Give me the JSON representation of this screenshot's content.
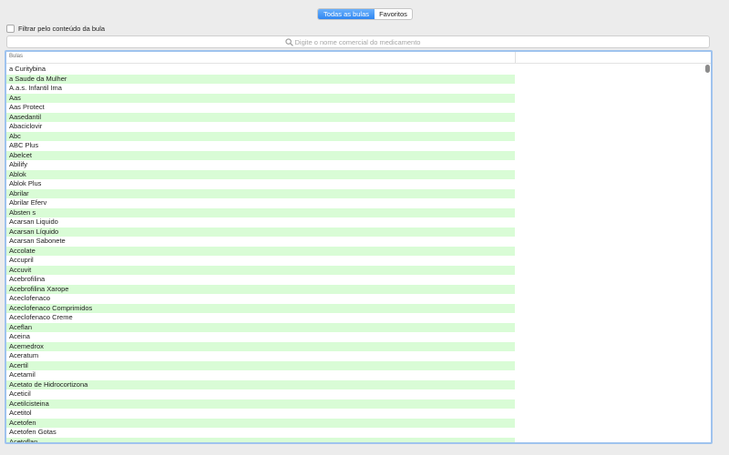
{
  "tabs": {
    "all_label": "Todas as bulas",
    "favorites_label": "Favoritos"
  },
  "filter": {
    "checked": false,
    "label": "Filtrar pelo conteúdo da bula"
  },
  "search": {
    "placeholder": "Digite o nome comercial do medicamento",
    "value": ""
  },
  "table": {
    "column_header": "Bulas",
    "rows": [
      "a Curitybina",
      "a Saude da Mulher",
      "A.a.s. Infantil Ima",
      "Aas",
      "Aas Protect",
      "Aasedantil",
      "Abaciclovir",
      "Abc",
      "ABC Plus",
      "Abelcet",
      "Abilify",
      "Ablok",
      "Ablok Plus",
      "Abrilar",
      "Abrilar Eferv",
      "Absten s",
      "Acarsan Liquido",
      "Acarsan Líquido",
      "Acarsan Sabonete",
      "Accolate",
      "Accupril",
      "Accuvit",
      "Acebrofilina",
      "Acebrofilina Xarope",
      "Aceclofenaco",
      "Aceclofenaco Comprimidos",
      "Aceclofenaco Creme",
      "Aceflan",
      "Aceina",
      "Acemedrox",
      "Aceratum",
      "Acertil",
      "Acetamil",
      "Acetato de Hidrocortizona",
      "Aceticil",
      "Acetilcisteina",
      "Acetitol",
      "Acetofen",
      "Acetofen Gotas",
      "Acetoflan"
    ]
  },
  "colors": {
    "accent": "#2f86f2",
    "row_stripe": "#d9fcd6",
    "focus_ring": "#9fc3ee"
  }
}
